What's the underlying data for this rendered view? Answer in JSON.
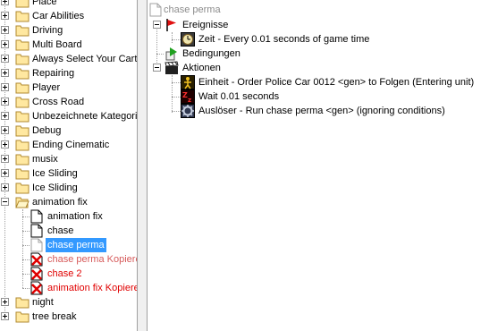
{
  "tree": {
    "folders_top": [
      {
        "label": "Place"
      },
      {
        "label": "Car Abilities"
      },
      {
        "label": "Driving"
      },
      {
        "label": "Multi Board"
      },
      {
        "label": "Always Select Your Cart"
      },
      {
        "label": "Repairing"
      },
      {
        "label": "Player"
      },
      {
        "label": "Cross Road"
      },
      {
        "label": "Unbezeichnete Kategorie"
      },
      {
        "label": "Debug"
      },
      {
        "label": "Ending Cinematic"
      },
      {
        "label": "musix"
      },
      {
        "label": "Ice Sliding"
      },
      {
        "label": "Ice Sliding"
      }
    ],
    "open_folder": {
      "label": "animation fix"
    },
    "triggers": [
      {
        "label": "animation fix",
        "state": "normal"
      },
      {
        "label": "chase",
        "state": "normal"
      },
      {
        "label": "chase perma",
        "state": "selected"
      },
      {
        "label": "chase perma Kopieren",
        "state": "disabled"
      },
      {
        "label": "chase 2",
        "state": "error"
      },
      {
        "label": "animation fix Kopieren",
        "state": "error"
      }
    ],
    "folders_bottom": [
      {
        "label": "night"
      },
      {
        "label": "tree break"
      }
    ]
  },
  "editor": {
    "title": "chase perma",
    "events_label": "Ereignisse",
    "event_1": "Zeit - Every 0.01 seconds of game time",
    "conditions_label": "Bedingungen",
    "actions_label": "Aktionen",
    "action_1": "Einheit - Order Police Car 0012 <gen> to Folgen (Entering unit)",
    "action_2": "Wait 0.01 seconds",
    "action_3": "Auslöser - Run chase perma <gen> (ignoring conditions)"
  },
  "colors": {
    "selection": "#3399ff",
    "error_text": "#e00000",
    "disabled_text": "#8c8c8c"
  }
}
